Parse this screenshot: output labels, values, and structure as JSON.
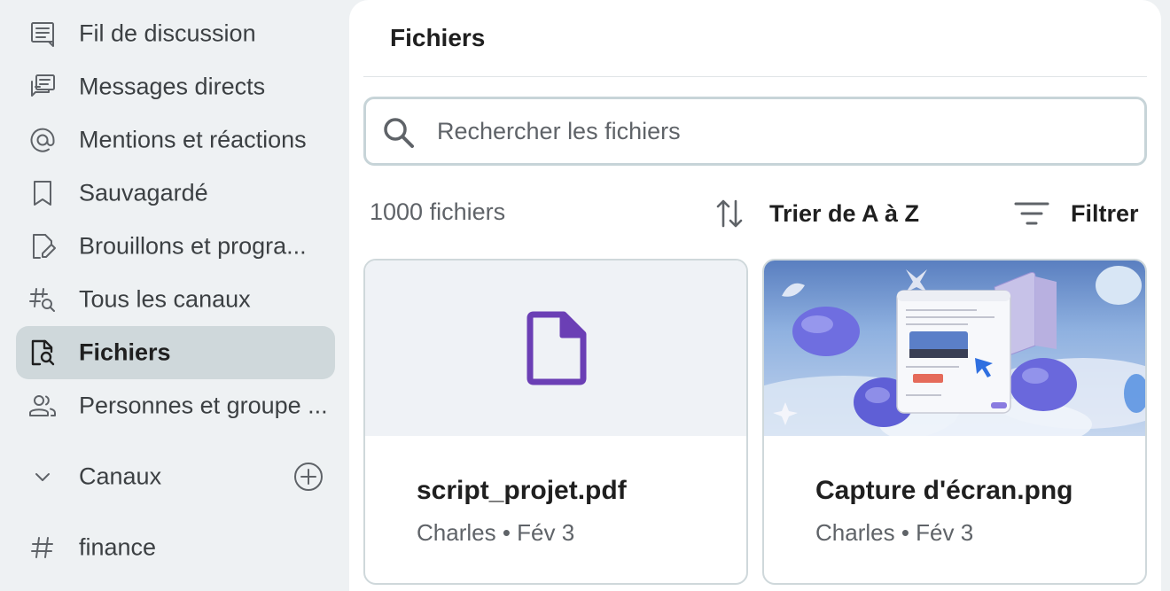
{
  "sidebar": {
    "items": [
      {
        "label": "Fil de discussion",
        "icon": "thread-icon"
      },
      {
        "label": "Messages directs",
        "icon": "direct-messages-icon"
      },
      {
        "label": "Mentions et réactions",
        "icon": "at-sign-icon"
      },
      {
        "label": "Sauvagardé",
        "icon": "bookmark-icon"
      },
      {
        "label": "Brouillons et progra...",
        "icon": "draft-edit-icon"
      },
      {
        "label": "Tous les canaux",
        "icon": "channel-search-icon"
      },
      {
        "label": "Fichiers",
        "icon": "file-search-icon",
        "active": true
      },
      {
        "label": "Personnes et groupe ...",
        "icon": "people-icon"
      }
    ],
    "channels_section": {
      "label": "Canaux",
      "expand_icon": "chevron-down-icon",
      "add_icon": "add-circle-icon"
    },
    "channels": [
      {
        "label": "finance",
        "icon": "hash-icon"
      }
    ]
  },
  "main": {
    "title": "Fichiers",
    "search": {
      "placeholder": "Rechercher les fichiers",
      "value": "",
      "icon": "search-icon"
    },
    "count": "1000 fichiers",
    "sort": {
      "label": "Trier de A à Z",
      "icon": "sort-arrows-icon"
    },
    "filter": {
      "label": "Filtrer",
      "icon": "filter-icon"
    },
    "files": [
      {
        "name": "script_projet.pdf",
        "meta": "Charles • Fév 3",
        "thumb": "document-icon"
      },
      {
        "name": "Capture d'écran.png",
        "meta": "Charles • Fév 3",
        "thumb": "image-preview"
      }
    ]
  },
  "colors": {
    "sidebar_bg": "#eef1f3",
    "active_bg": "#cfd8db",
    "accent_purple": "#6b3fb5",
    "text_secondary": "#5f6368"
  }
}
